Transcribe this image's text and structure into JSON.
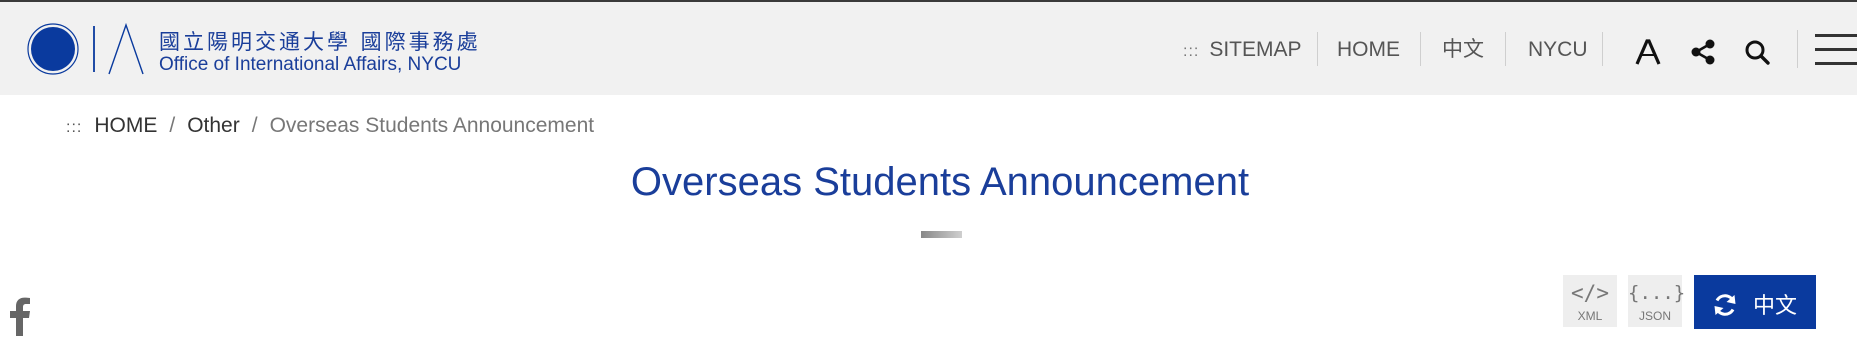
{
  "header": {
    "logo": {
      "name_zh": "國立陽明交通大學 國際事務處",
      "name_en": "Office of International Affairs, NYCU"
    },
    "nav": {
      "access_key": ":::",
      "items": [
        "SITEMAP",
        "HOME",
        "中文",
        "NYCU"
      ]
    },
    "icons": [
      "font-size-icon",
      "share-icon",
      "search-icon",
      "menu-icon"
    ]
  },
  "breadcrumb": {
    "access_key": ":::",
    "separator": "/",
    "items": [
      "HOME",
      "Other",
      "Overseas Students Announcement"
    ]
  },
  "page": {
    "title": "Overseas Students Announcement"
  },
  "sidebar": {
    "social": [
      "facebook-icon"
    ]
  },
  "toolbar": {
    "xml": {
      "glyph": "</>",
      "label": "XML"
    },
    "json": {
      "glyph": "{...}",
      "label": "JSON"
    },
    "language_button": {
      "label": "中文"
    }
  },
  "colors": {
    "brand_blue": "#1a3e9a",
    "button_blue": "#0a3a9e",
    "header_bg": "#f1f1f1"
  }
}
